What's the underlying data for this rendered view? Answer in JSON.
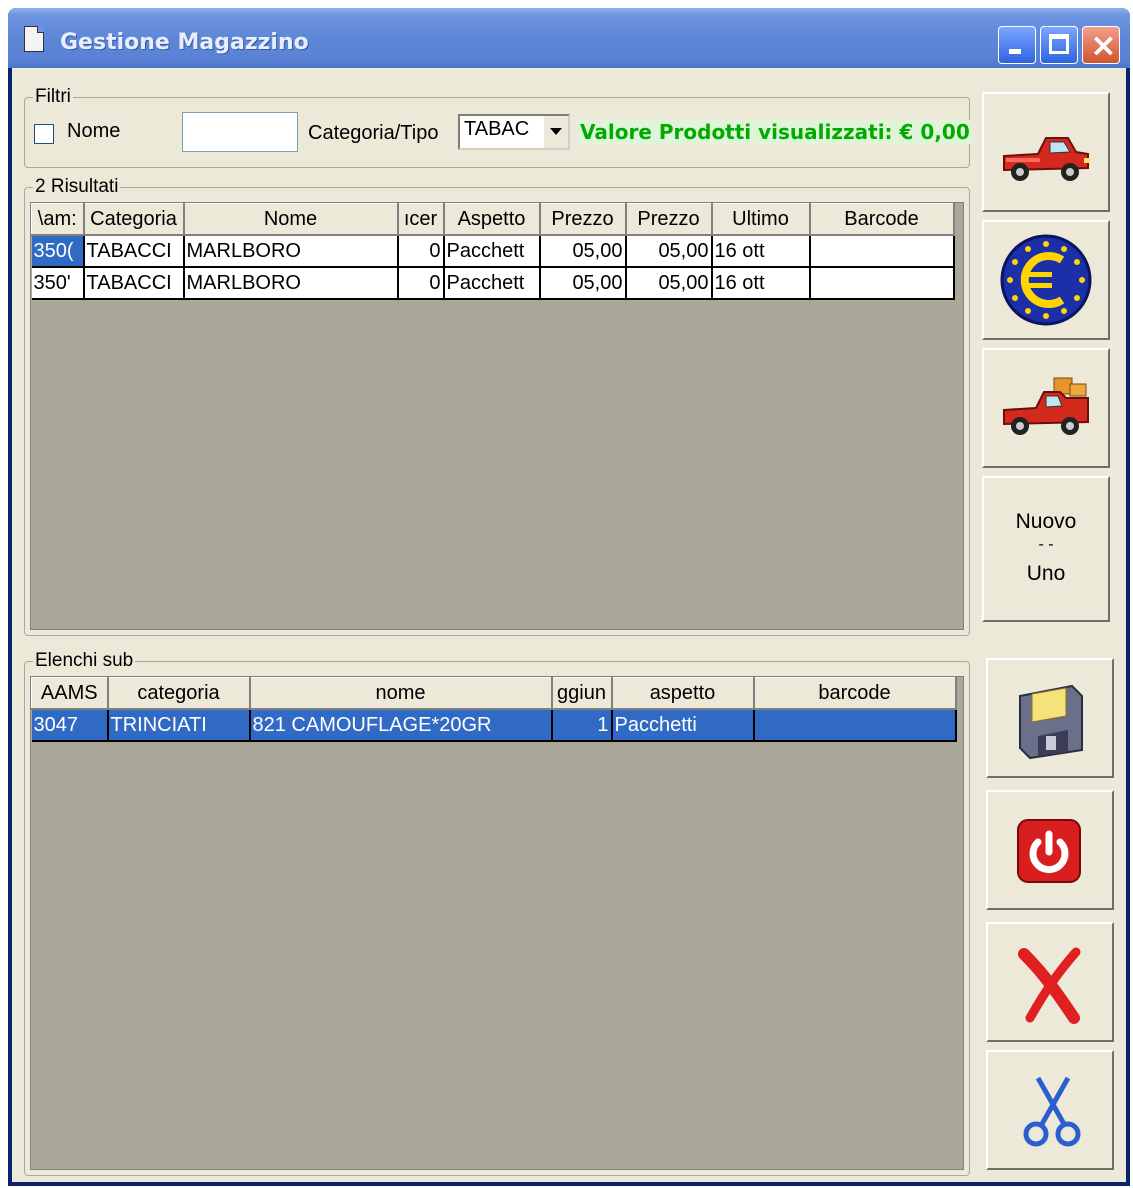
{
  "window": {
    "title": "Gestione Magazzino"
  },
  "filters": {
    "legend": "Filtri",
    "nome_label": "Nome",
    "nome_value": "",
    "categoria_label": "Categoria/Tipo",
    "categoria_value": "TABAC",
    "valore_text": "Valore Prodotti visualizzati: € 0,00"
  },
  "results": {
    "legend": "2 Risultati",
    "columns": [
      "\\am:",
      "Categoria",
      "Nome",
      "ıcer",
      "Aspetto",
      "Prezzo",
      "Prezzo",
      "Ultimo",
      "Barcode"
    ],
    "rows": [
      [
        "350(",
        "TABACCI",
        "MARLBORO",
        "0",
        "Pacchett",
        "05,00",
        "05,00",
        "16 ott",
        ""
      ],
      [
        "350'",
        "TABACCI",
        "MARLBORO",
        "0",
        "Pacchett",
        "05,00",
        "05,00",
        "16 ott",
        ""
      ]
    ]
  },
  "sub": {
    "legend": "Elenchi sub",
    "columns": [
      "AAMS",
      "categoria",
      "nome",
      "ggiun",
      "aspetto",
      "barcode"
    ],
    "rows": [
      [
        "3047",
        "TRINCIATI",
        "821 CAMOUFLAGE*20GR",
        "1",
        "Pacchetti",
        ""
      ]
    ]
  },
  "buttons": {
    "truck": "truck-icon",
    "euro": "euro-icon",
    "loaded_truck": "loaded-truck-icon",
    "nuovo_line1": "Nuovo",
    "nuovo_line2": "- -",
    "nuovo_line3": "Uno",
    "save": "floppy-disk-icon",
    "power": "power-icon",
    "delete": "red-x-icon",
    "cut": "scissors-icon"
  },
  "colors": {
    "titlebar": "#5a82d4",
    "selection": "#316ac5",
    "grid_bg": "#aca899",
    "valore_text": "#00aa00"
  }
}
